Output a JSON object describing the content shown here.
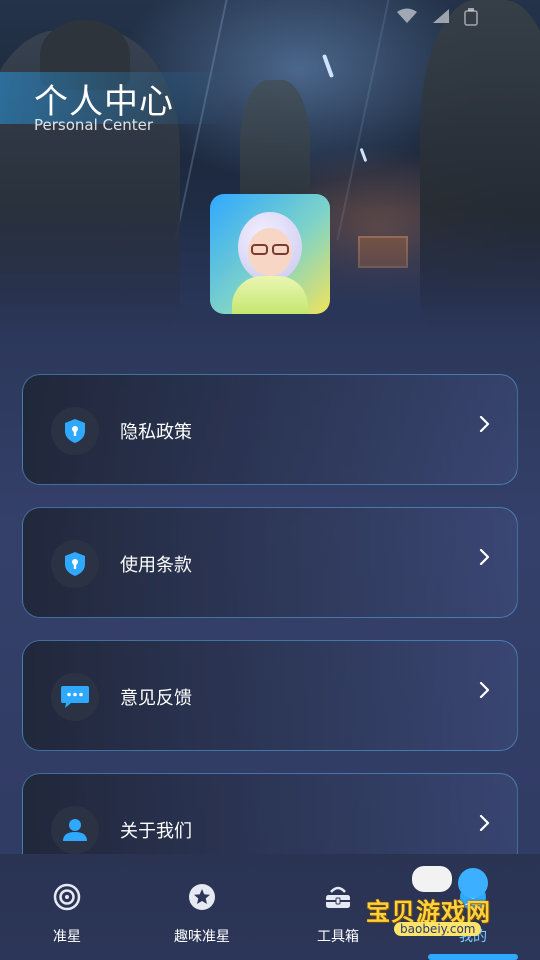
{
  "header": {
    "title": "个人中心",
    "subtitle": "Personal Center"
  },
  "menu": {
    "items": [
      {
        "label": "隐私政策",
        "icon": "shield-lock-icon"
      },
      {
        "label": "使用条款",
        "icon": "shield-lock-icon"
      },
      {
        "label": "意见反馈",
        "icon": "chat-bubble-icon"
      },
      {
        "label": "关于我们",
        "icon": "user-icon"
      }
    ]
  },
  "tabbar": {
    "items": [
      {
        "label": "准星",
        "icon": "crosshair-icon"
      },
      {
        "label": "趣味准星",
        "icon": "star-circle-icon"
      },
      {
        "label": "工具箱",
        "icon": "toolbox-icon"
      },
      {
        "label": "我的",
        "icon": "profile-icon"
      }
    ],
    "active": "我的"
  },
  "watermark": {
    "text": "宝贝游戏网",
    "url": "baobeiy.com"
  },
  "colors": {
    "accent": "#2fa8ff",
    "card_border": "#5aaae6",
    "background": "#2f3a62"
  }
}
